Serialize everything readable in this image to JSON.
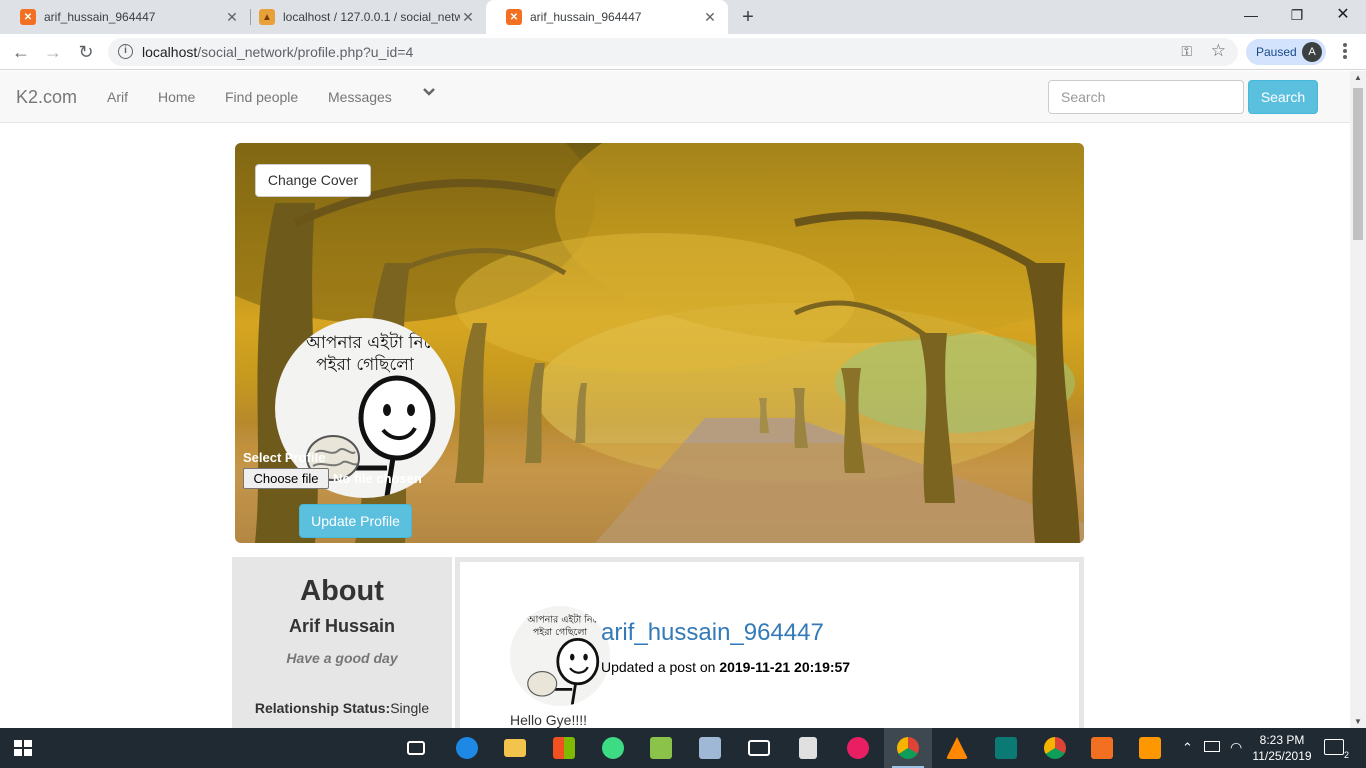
{
  "browser": {
    "tabs": [
      {
        "title": "arif_hussain_964447",
        "favicon": "xampp-icon"
      },
      {
        "title": "localhost / 127.0.0.1 / social_netw",
        "favicon": "phpmyadmin-icon"
      },
      {
        "title": "arif_hussain_964447",
        "favicon": "xampp-icon"
      }
    ],
    "url_host": "localhost",
    "url_path": "/social_network/profile.php?u_id=4",
    "profile_status": "Paused",
    "profile_initial": "A"
  },
  "navbar": {
    "brand": "K2.com",
    "links": [
      "Arif",
      "Home",
      "Find people",
      "Messages"
    ],
    "search_placeholder": "Search",
    "search_button": "Search"
  },
  "cover": {
    "change_cover_label": "Change Cover",
    "avatar_caption_line1": "আপনার এইটা নিবে",
    "avatar_caption_line2": "পইরা গেছিলো",
    "select_profile_label": "Select Profile",
    "choose_file_label": "Choose file",
    "no_file_label": "No file chosen",
    "update_profile_label": "Update Profile"
  },
  "about": {
    "heading": "About",
    "name": "Arif Hussain",
    "motto": "Have a good day",
    "relationship_label": "Relationship Status:",
    "relationship_value": "Single"
  },
  "post": {
    "username": "arif_hussain_964447",
    "action_text": "Updated a post on ",
    "timestamp": "2019-11-21 20:19:57",
    "body": "Hello Gye!!!!"
  },
  "taskbar": {
    "time": "8:23 PM",
    "date": "11/25/2019",
    "notification_count": "2",
    "apps": [
      "task-view-icon",
      "edge-icon",
      "file-explorer-icon",
      "store-icon",
      "android-studio-icon",
      "notepad-icon",
      "virtualbox-icon",
      "mail-icon",
      "calculator-icon",
      "paint-icon",
      "chrome-icon",
      "vlc-icon",
      "ps-icon",
      "chrome-icon",
      "xampp-icon",
      "sublime-icon"
    ]
  },
  "colors": {
    "accent": "#5bc0de",
    "link": "#337ab7",
    "taskbar": "#1f2a33"
  }
}
